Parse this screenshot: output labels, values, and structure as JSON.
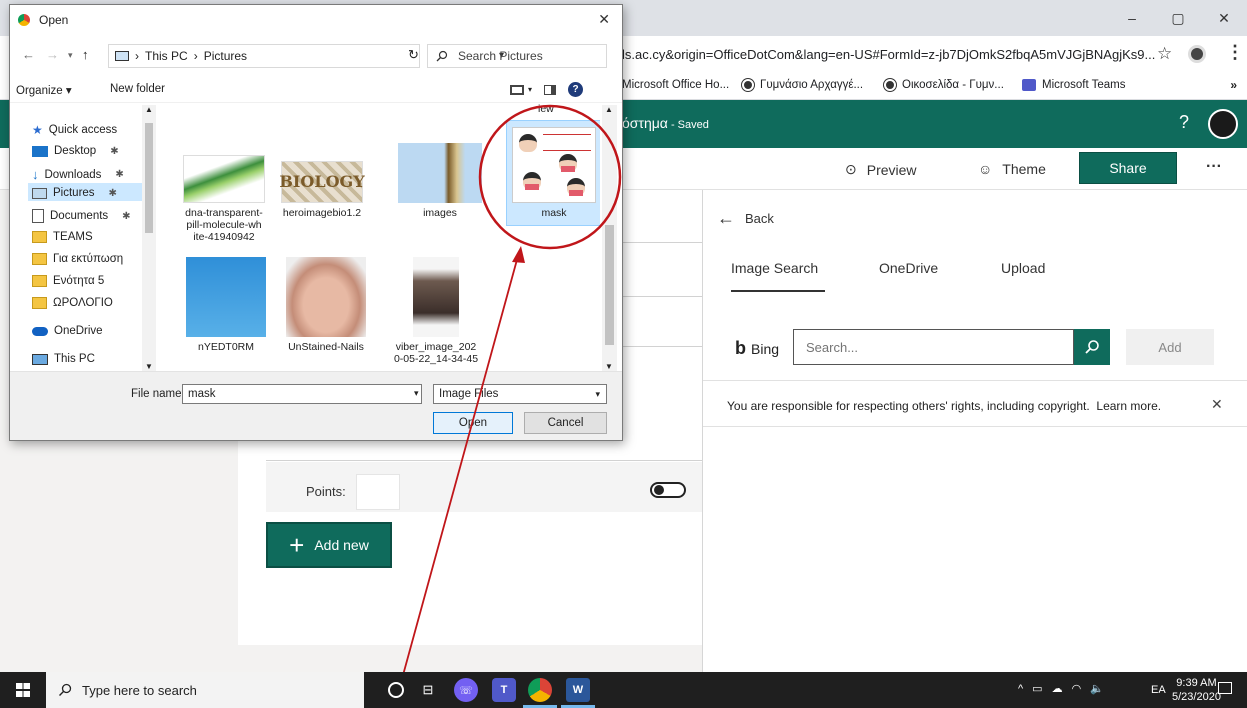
{
  "browser": {
    "window_controls": [
      "–",
      "▢",
      "✕"
    ],
    "url": "ls.ac.cy&origin=OfficeDotCom&lang=en-US#FormId=z-jb7DjOmkS2fbqA5mVJGjBNAgjKs9...",
    "bookmarks": [
      {
        "label": "Microsoft Office Ho..."
      },
      {
        "label": "Γυμνάσιο Αρχαγγέ..."
      },
      {
        "label": "Οικοσελίδα - Γυμν..."
      },
      {
        "label": "Microsoft Teams"
      }
    ],
    "bookmarks_more": "»"
  },
  "forms": {
    "title": "όστημα",
    "saved": " - Saved",
    "help": "?",
    "toolbar": {
      "preview": "Preview",
      "theme": "Theme",
      "share": "Share",
      "more": "···"
    },
    "points_label": "Points:",
    "add_new": "Add new"
  },
  "panel": {
    "back": "Back",
    "tabs": [
      "Image Search",
      "OneDrive",
      "Upload"
    ],
    "active_tab": "Image Search",
    "bing_label": "Bing",
    "search_placeholder": "Search...",
    "add_button": "Add",
    "notice": "You are responsible for respecting others' rights, including copyright.",
    "learn_more": "Learn more.",
    "close": "✕"
  },
  "dialog": {
    "title": "Open",
    "close": "✕",
    "path": [
      "This PC",
      "Pictures"
    ],
    "search_placeholder": "Search Pictures",
    "organize": "Organize ▾",
    "new_folder": "New folder",
    "nav_items": [
      {
        "label": "Quick access",
        "icon": "star-icon"
      },
      {
        "label": "Desktop",
        "icon": "desktop-icon",
        "pinned": true
      },
      {
        "label": "Downloads",
        "icon": "download-icon",
        "pinned": true
      },
      {
        "label": "Pictures",
        "icon": "pictures-icon",
        "pinned": true
      },
      {
        "label": "Documents",
        "icon": "documents-icon",
        "pinned": true
      },
      {
        "label": "TEAMS",
        "icon": "folder-icon"
      },
      {
        "label": "Για εκτύπωση",
        "icon": "folder-icon"
      },
      {
        "label": "Ενότητα 5",
        "icon": "folder-icon"
      },
      {
        "label": "ΩΡΟΛΟΓΙΟ",
        "icon": "folder-icon"
      },
      {
        "label": "OneDrive",
        "icon": "cloud-icon"
      },
      {
        "label": "This PC",
        "icon": "pc-icon"
      }
    ],
    "partial_label": "iew",
    "files": [
      {
        "name": "dna-transparent-pill-molecule-white-41940942",
        "lines": [
          "dna-transparent-",
          "pill-molecule-wh",
          "ite-41940942"
        ]
      },
      {
        "name": "heroimagebio1.2",
        "lines": [
          "heroimagebio1.2"
        ],
        "thumb_text": "BIOLOGY"
      },
      {
        "name": "images",
        "lines": [
          "images"
        ]
      },
      {
        "name": "mask",
        "lines": [
          "mask"
        ],
        "selected": true
      },
      {
        "name": "nYEDT0RM",
        "lines": [
          "nYEDT0RM"
        ]
      },
      {
        "name": "UnStained-Nails",
        "lines": [
          "UnStained-Nails"
        ]
      },
      {
        "name": "viber_image_2020-05-22_14-34-45",
        "lines": [
          "viber_image_202",
          "0-05-22_14-34-45"
        ]
      }
    ],
    "file_name_label": "File name:",
    "file_name_value": "mask",
    "file_type": "Image Files",
    "open_button": "Open",
    "cancel_button": "Cancel"
  },
  "taskbar": {
    "search_placeholder": "Type here to search",
    "tray_lang": "EA",
    "time": "9:39 AM",
    "date": "5/23/2020"
  },
  "colors": {
    "forms_green": "#0f6b5c",
    "annotation_red": "#c0161a",
    "selection_blue": "#cce8ff"
  }
}
